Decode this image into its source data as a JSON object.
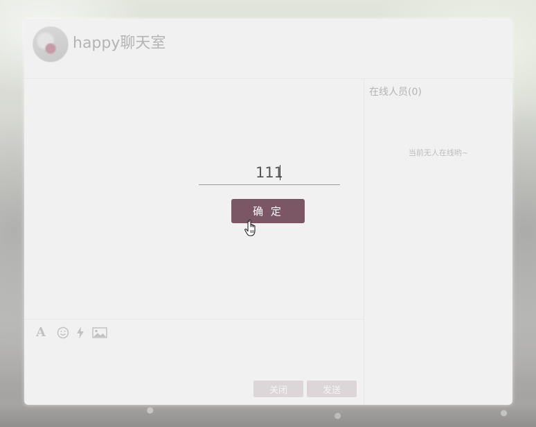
{
  "header": {
    "title": "happy聊天室",
    "avatar_icon": "avatar-image"
  },
  "login": {
    "name_value": "111",
    "confirm_label": "确 定",
    "accent_color": "#7b5766"
  },
  "online": {
    "title": "在线人员(0)",
    "empty_text": "当前无人在线哟~"
  },
  "toolbar": {
    "icons": [
      "font-icon",
      "emoji-icon",
      "flash-icon",
      "image-icon"
    ]
  },
  "footer": {
    "close_label": "关闭",
    "send_label": "发送"
  }
}
